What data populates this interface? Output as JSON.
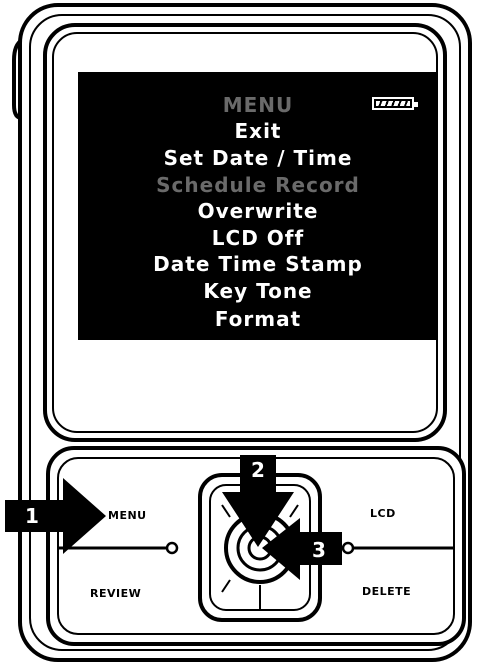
{
  "screen": {
    "title": "MENU",
    "items": [
      {
        "label": "Exit",
        "enabled": true
      },
      {
        "label": "Set Date / Time",
        "enabled": true
      },
      {
        "label": "Schedule Record",
        "enabled": false
      },
      {
        "label": "Overwrite",
        "enabled": true
      },
      {
        "label": "LCD Off",
        "enabled": true
      },
      {
        "label": "Date Time Stamp",
        "enabled": true
      },
      {
        "label": "Key Tone",
        "enabled": true
      },
      {
        "label": "Format",
        "enabled": true
      }
    ],
    "battery_icon": "battery-full-icon"
  },
  "buttons": {
    "menu": "MENU",
    "review": "REVIEW",
    "lcd": "LCD",
    "delete": "DELETE"
  },
  "callouts": [
    "1",
    "2",
    "3"
  ]
}
